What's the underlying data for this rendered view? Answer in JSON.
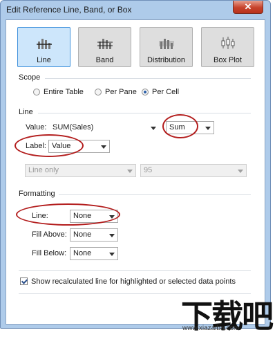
{
  "window": {
    "title": "Edit Reference Line, Band, or Box",
    "close_symbol": "✕"
  },
  "type_buttons": [
    {
      "label": "Line",
      "icon": "line-chart-icon",
      "selected": true
    },
    {
      "label": "Band",
      "icon": "band-chart-icon",
      "selected": false
    },
    {
      "label": "Distribution",
      "icon": "distribution-chart-icon",
      "selected": false
    },
    {
      "label": "Box Plot",
      "icon": "box-plot-icon",
      "selected": false
    }
  ],
  "scope": {
    "heading": "Scope",
    "options": [
      "Entire Table",
      "Per Pane",
      "Per Cell"
    ],
    "selected": "Per Cell"
  },
  "line_section": {
    "heading": "Line",
    "value_label": "Value:",
    "value": "SUM(Sales)",
    "aggregation": "Sum",
    "label_label": "Label:",
    "label_value": "Value",
    "ci_mode": "Line only",
    "ci_percent": "95"
  },
  "formatting": {
    "heading": "Formatting",
    "line_label": "Line:",
    "line_value": "None",
    "fill_above_label": "Fill Above:",
    "fill_above_value": "None",
    "fill_below_label": "Fill Below:",
    "fill_below_value": "None"
  },
  "recalc": {
    "checked": true,
    "label": "Show recalculated line for highlighted or selected data points"
  },
  "watermark": {
    "text": "下载吧",
    "url": "www.xiazaiba.com"
  },
  "colors": {
    "accent": "#3c8fdb",
    "annotation": "#b31d1d",
    "frame": "#aecbea"
  }
}
